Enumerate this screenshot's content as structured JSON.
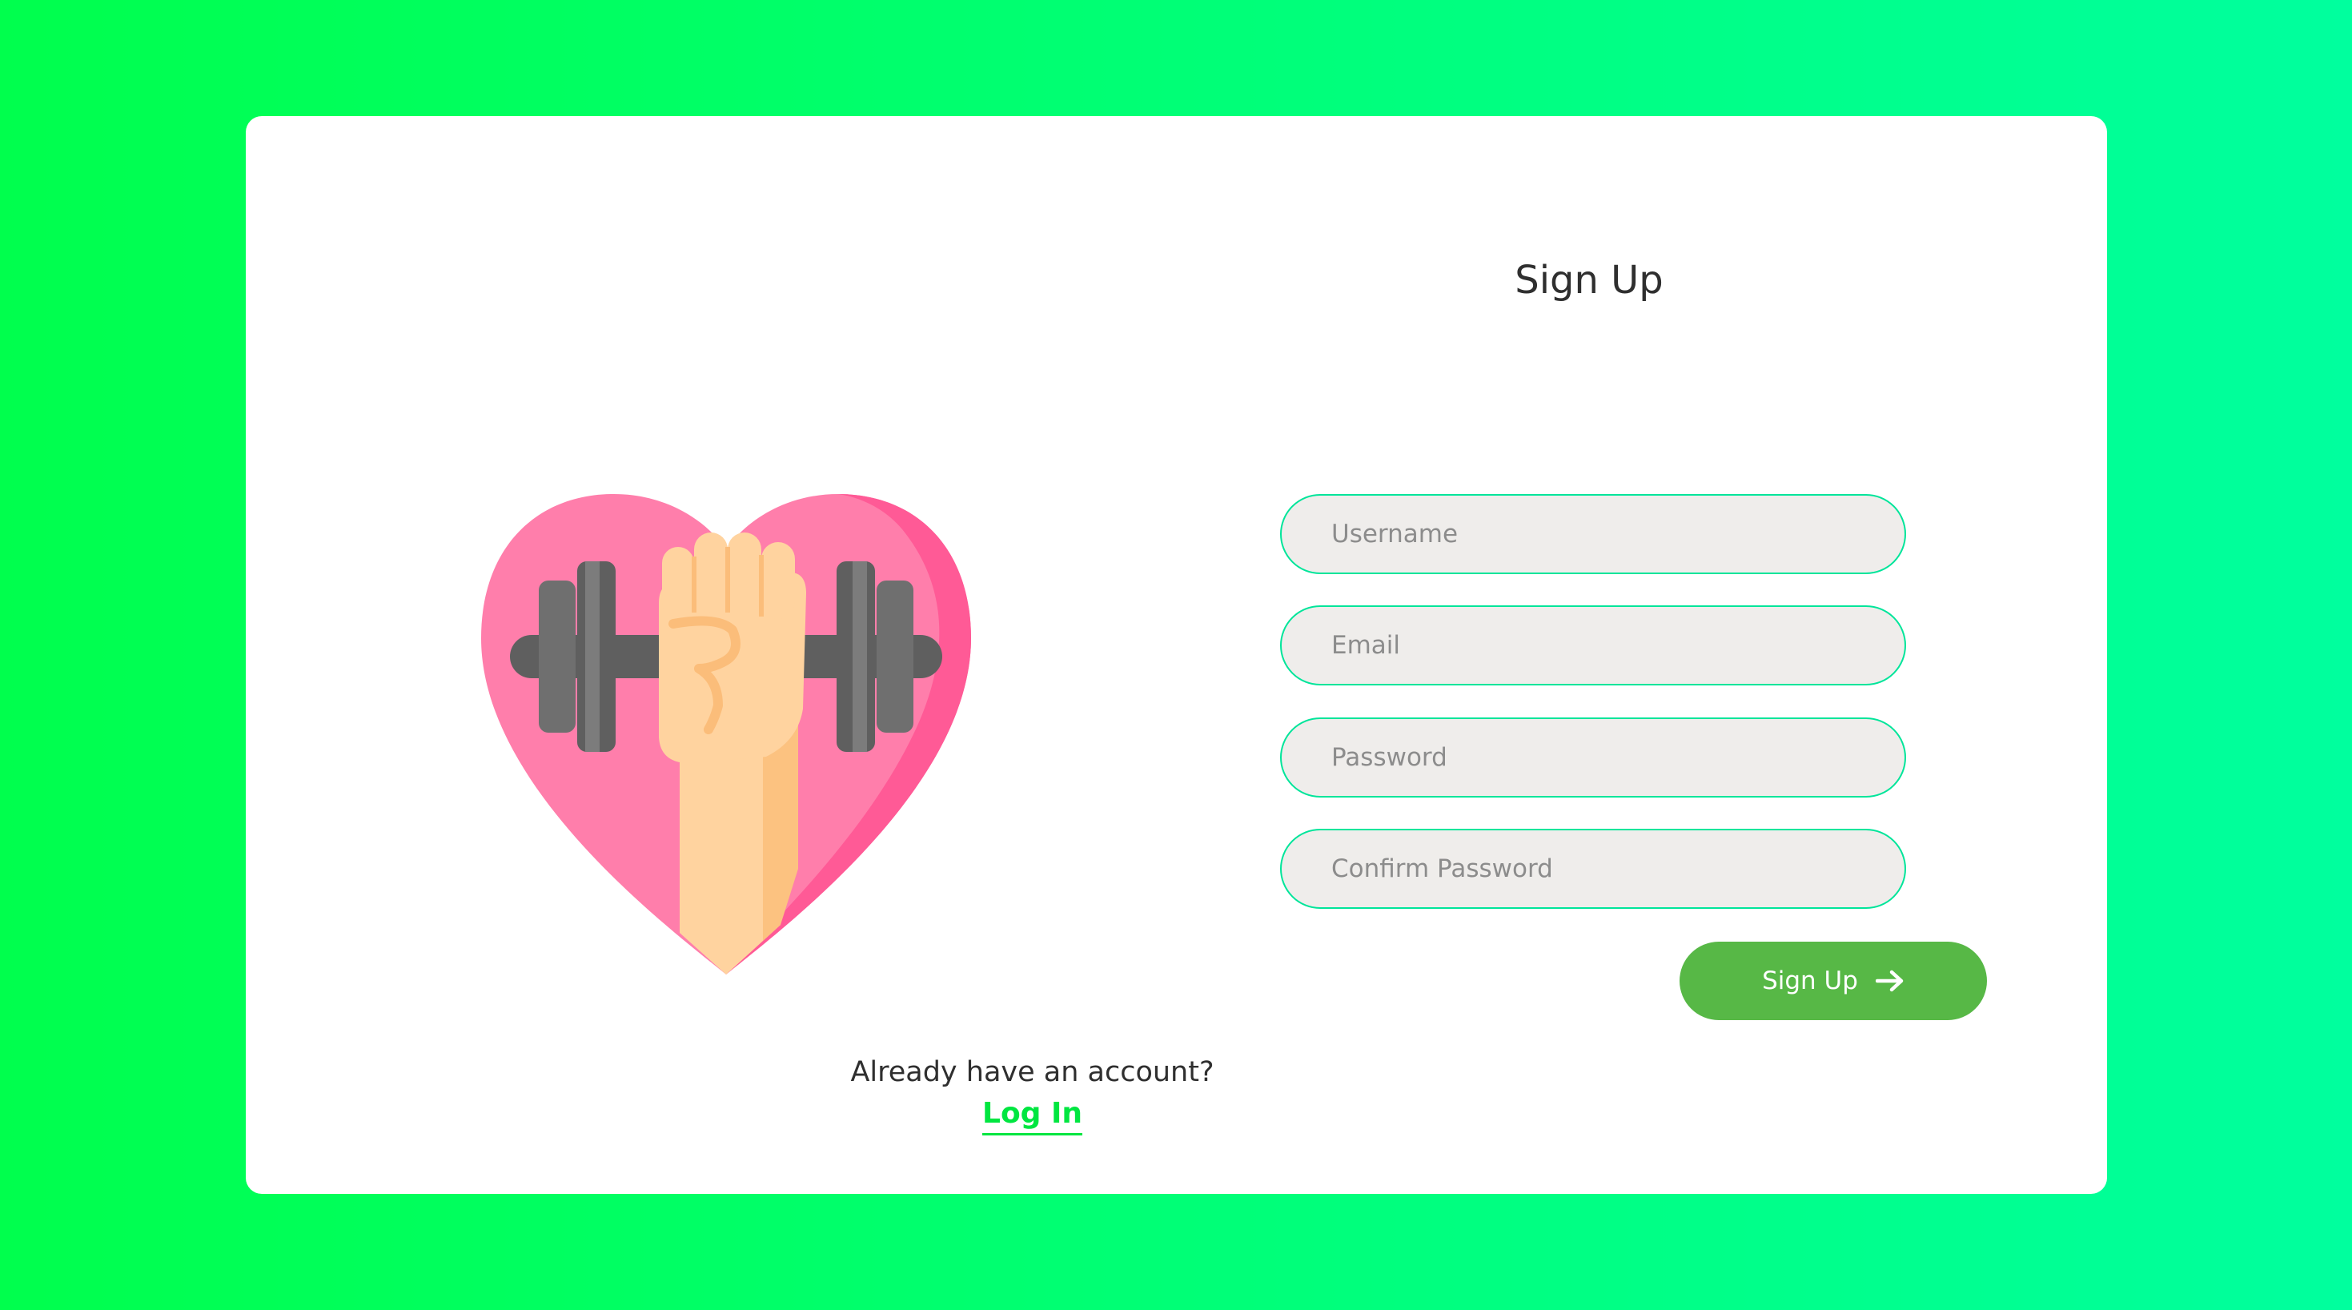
{
  "form": {
    "title": "Sign Up",
    "fields": [
      {
        "placeholder": "Username",
        "value": ""
      },
      {
        "placeholder": "Email",
        "value": ""
      },
      {
        "placeholder": "Password",
        "value": ""
      },
      {
        "placeholder": "Confirm Password",
        "value": ""
      }
    ],
    "submit_label": "Sign Up"
  },
  "footer": {
    "question": "Already have an account?",
    "login_label": "Log In"
  },
  "icons": {
    "illustration": "heart-dumbbell-fist-icon",
    "submit_arrow": "arrow-right-icon"
  },
  "colors": {
    "background_gradient": [
      "#00ff4d",
      "#00ff9e"
    ],
    "card": "#ffffff",
    "field_border": "#00e59a",
    "field_fill": "#efedeb",
    "button": "#57b846",
    "link": "#00e640",
    "heart": "#ff7eab",
    "heart_shade": "#ff5a96",
    "dumbbell_bar": "#5f5f5f",
    "dumbbell_plate": "#6f6f6f",
    "skin": "#ffd39f"
  }
}
